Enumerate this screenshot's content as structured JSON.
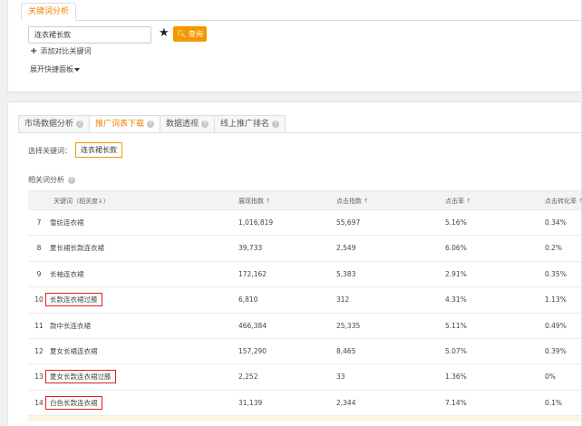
{
  "top": {
    "tab_label": "关键词分析",
    "input_value": "连衣裙长款",
    "query_label": "查询",
    "add_compare": "添加对比关键词",
    "expand_panel": "展开快捷面板"
  },
  "main": {
    "tabs": [
      {
        "label": "市场数据分析"
      },
      {
        "label": "推广词表下载"
      },
      {
        "label": "数据透视"
      },
      {
        "label": "线上推广排名"
      }
    ],
    "select_label": "选择关键词：",
    "selected_keyword": "连衣裙长款",
    "related_title": "相关词分析",
    "columns": [
      "关键词（相关度↓）",
      "展现指数",
      "点击指数",
      "点击率",
      "点击转化率"
    ],
    "rows": [
      {
        "idx": "7",
        "kw": "雪纺连衣裙",
        "v1": "1,016,819",
        "v2": "55,697",
        "v3": "5.16%",
        "v4": "0.34%",
        "hl": false
      },
      {
        "idx": "8",
        "kw": "夏长裙长款连衣裙",
        "v1": "39,733",
        "v2": "2,549",
        "v3": "6.06%",
        "v4": "0.2%",
        "hl": false
      },
      {
        "idx": "9",
        "kw": "长袖连衣裙",
        "v1": "172,162",
        "v2": "5,383",
        "v3": "2.91%",
        "v4": "0.35%",
        "hl": false
      },
      {
        "idx": "10",
        "kw": "长款连衣裙过膝",
        "v1": "6,810",
        "v2": "312",
        "v3": "4.31%",
        "v4": "1.13%",
        "hl": true
      },
      {
        "idx": "11",
        "kw": "款中长连衣裙",
        "v1": "466,384",
        "v2": "25,335",
        "v3": "5.11%",
        "v4": "0.49%",
        "hl": false
      },
      {
        "idx": "12",
        "kw": "夏女长裙连衣裙",
        "v1": "157,290",
        "v2": "8,465",
        "v3": "5.07%",
        "v4": "0.39%",
        "hl": false
      },
      {
        "idx": "13",
        "kw": "夏女长款连衣裙过膝",
        "v1": "2,252",
        "v2": "33",
        "v3": "1.36%",
        "v4": "0%",
        "hl": true
      },
      {
        "idx": "14",
        "kw": "白色长款连衣裙",
        "v1": "31,139",
        "v2": "2,344",
        "v3": "7.14%",
        "v4": "0.1%",
        "hl": true
      }
    ]
  },
  "colors": {
    "accent": "#f39800",
    "highlight": "#e02020"
  }
}
